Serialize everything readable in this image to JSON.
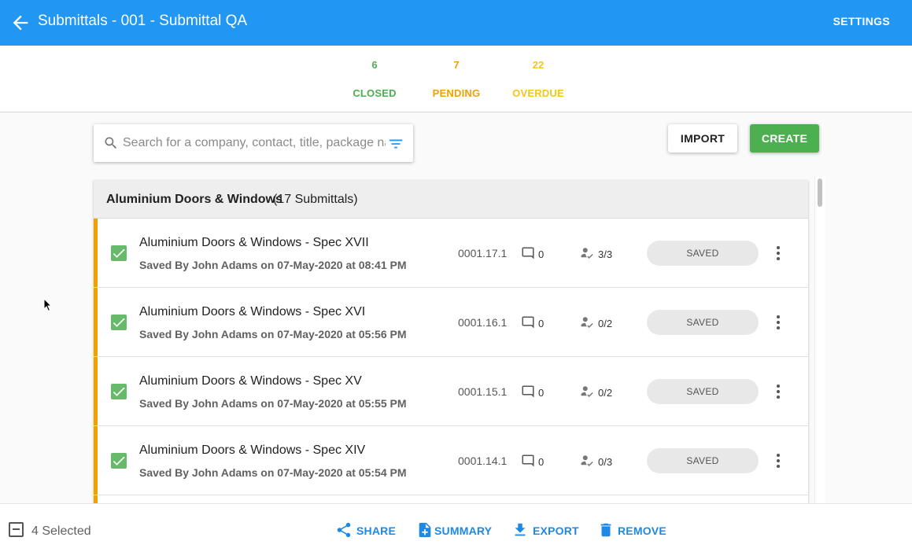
{
  "appbar": {
    "title": "Submittals - 001 - Submittal QA",
    "settings_label": "SETTINGS",
    "back_icon": "arrow-left-icon",
    "color": "#2196f3"
  },
  "stats": [
    {
      "value": "6",
      "label": "CLOSED",
      "color": "#4caf50"
    },
    {
      "value": "7",
      "label": "PENDING",
      "color": "#f0a000"
    },
    {
      "value": "22",
      "label": "OVERDUE",
      "color": "#f5c518"
    }
  ],
  "search": {
    "placeholder": "Search for a company, contact, title, package name",
    "value": "",
    "icon": "search-icon",
    "filter_icon": "filter-icon"
  },
  "toolbar": {
    "import_label": "IMPORT",
    "create_label": "CREATE"
  },
  "group": {
    "name": "Aluminium Doors & Windows",
    "count_text": "(17 Submittals)"
  },
  "rows": [
    {
      "title": "Aluminium Doors & Windows - Spec XVII",
      "subtitle": "Saved By John Adams on 07-May-2020 at 08:41 PM",
      "number": "0001.17.1",
      "comments": "0",
      "approvals": "3/3",
      "status": "SAVED",
      "checked": true
    },
    {
      "title": "Aluminium Doors & Windows - Spec XVI",
      "subtitle": "Saved By John Adams on 07-May-2020 at 05:56 PM",
      "number": "0001.16.1",
      "comments": "0",
      "approvals": "0/2",
      "status": "SAVED",
      "checked": true
    },
    {
      "title": "Aluminium Doors & Windows - Spec XV",
      "subtitle": "Saved By John Adams on 07-May-2020 at 05:55 PM",
      "number": "0001.15.1",
      "comments": "0",
      "approvals": "0/2",
      "status": "SAVED",
      "checked": true
    },
    {
      "title": "Aluminium Doors & Windows - Spec XIV",
      "subtitle": "Saved By John Adams on 07-May-2020 at 05:54 PM",
      "number": "0001.14.1",
      "comments": "0",
      "approvals": "0/3",
      "status": "SAVED",
      "checked": true
    }
  ],
  "bottom": {
    "selected_text": "4 Selected",
    "share_label": "SHARE",
    "summary_label": "SUMMARY",
    "export_label": "EXPORT",
    "remove_label": "REMOVE",
    "action_color": "#1e88e5"
  }
}
